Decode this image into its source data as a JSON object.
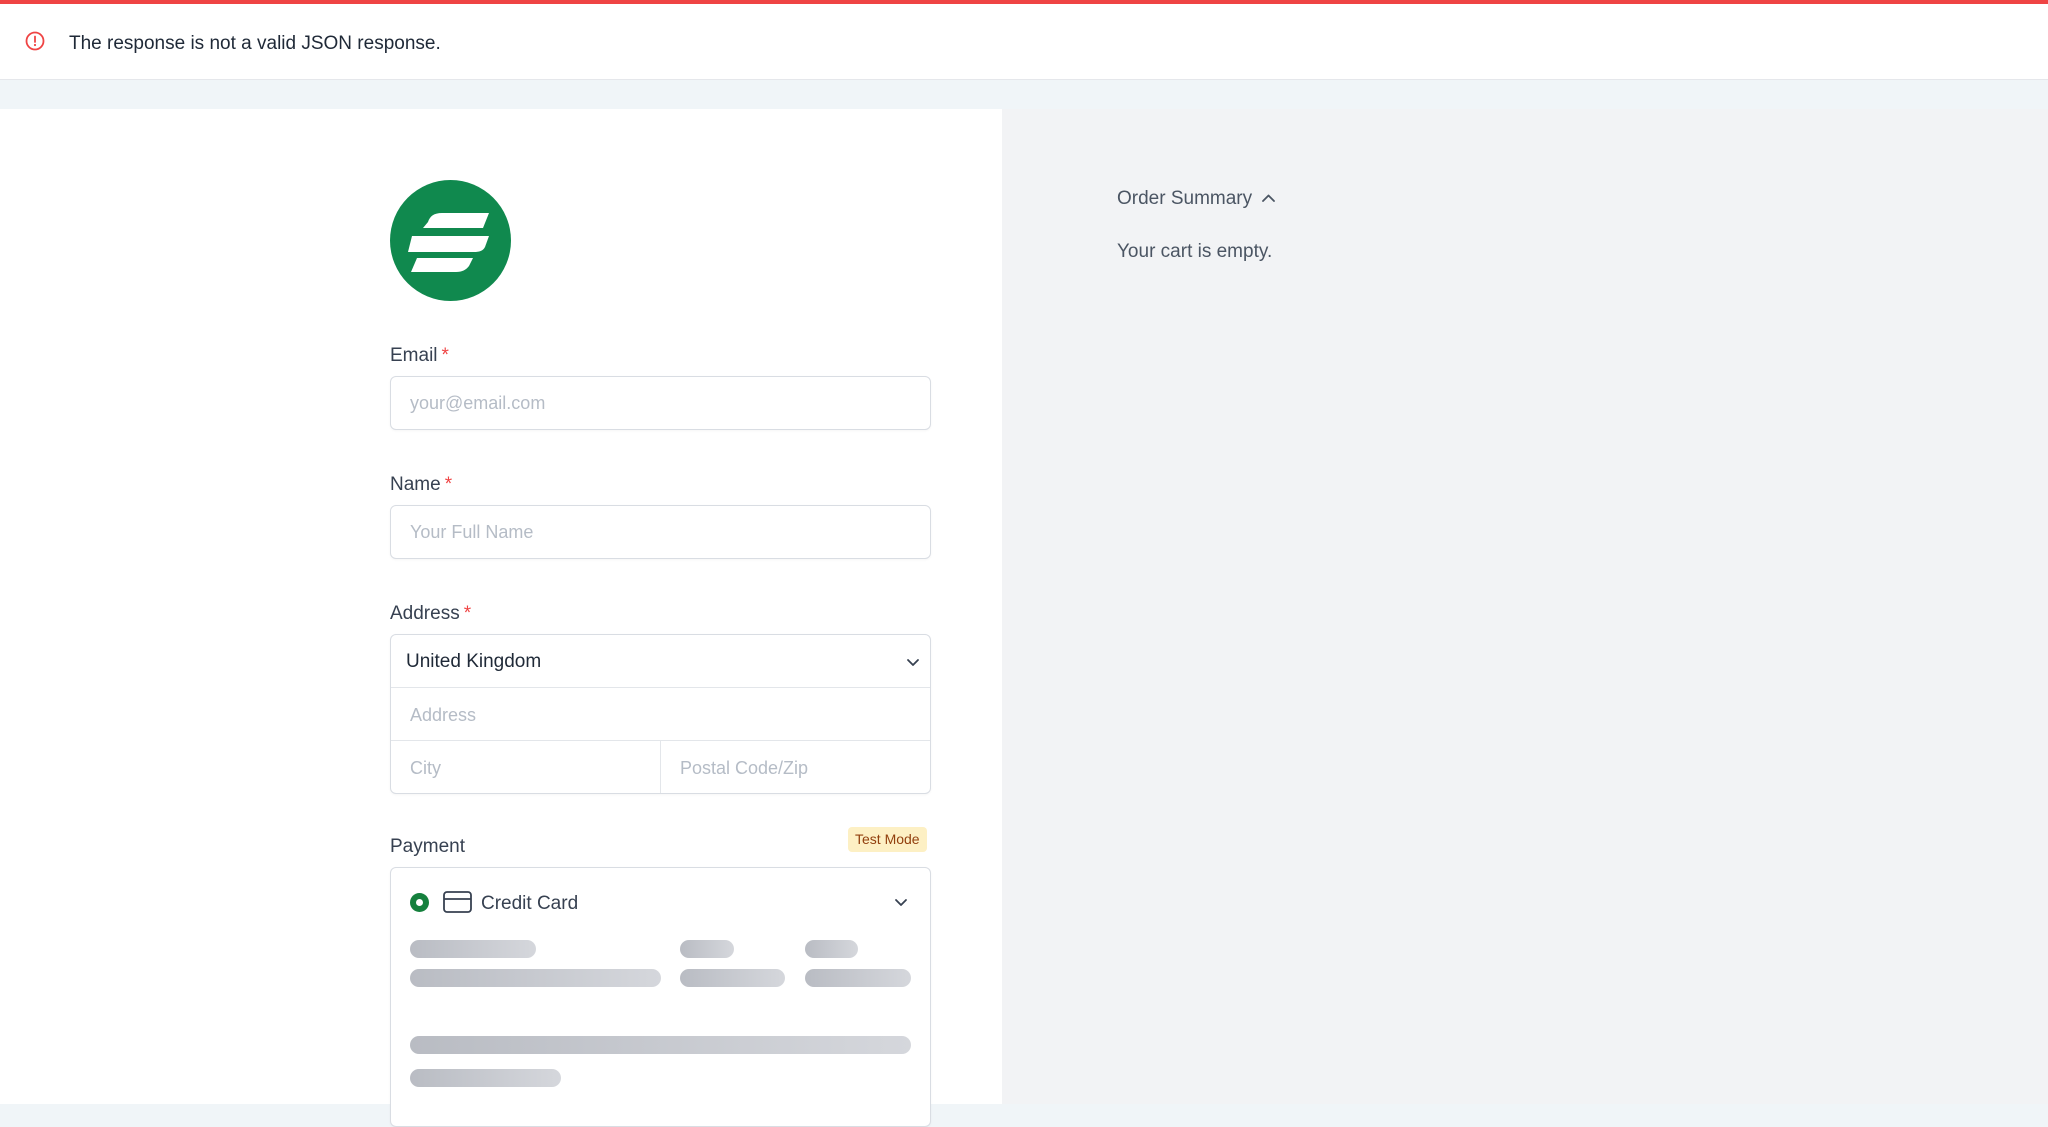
{
  "notice": {
    "message": "The response is not a valid JSON response.",
    "icon": "alert-circle-icon",
    "color": "#ef4444"
  },
  "brand": {
    "logo_icon": "surecart-logo-icon",
    "color": "#10894e"
  },
  "form": {
    "email": {
      "label": "Email",
      "required_mark": "*",
      "placeholder": "your@email.com"
    },
    "name": {
      "label": "Name",
      "required_mark": "*",
      "placeholder": "Your Full Name"
    },
    "address": {
      "label": "Address",
      "required_mark": "*",
      "country": "United Kingdom",
      "address_placeholder": "Address",
      "city_placeholder": "City",
      "postal_placeholder": "Postal Code/Zip"
    },
    "payment": {
      "label": "Payment",
      "badge": "Test Mode",
      "method": "Credit Card"
    }
  },
  "order_summary": {
    "title": "Order Summary",
    "empty_text": "Your cart is empty."
  }
}
